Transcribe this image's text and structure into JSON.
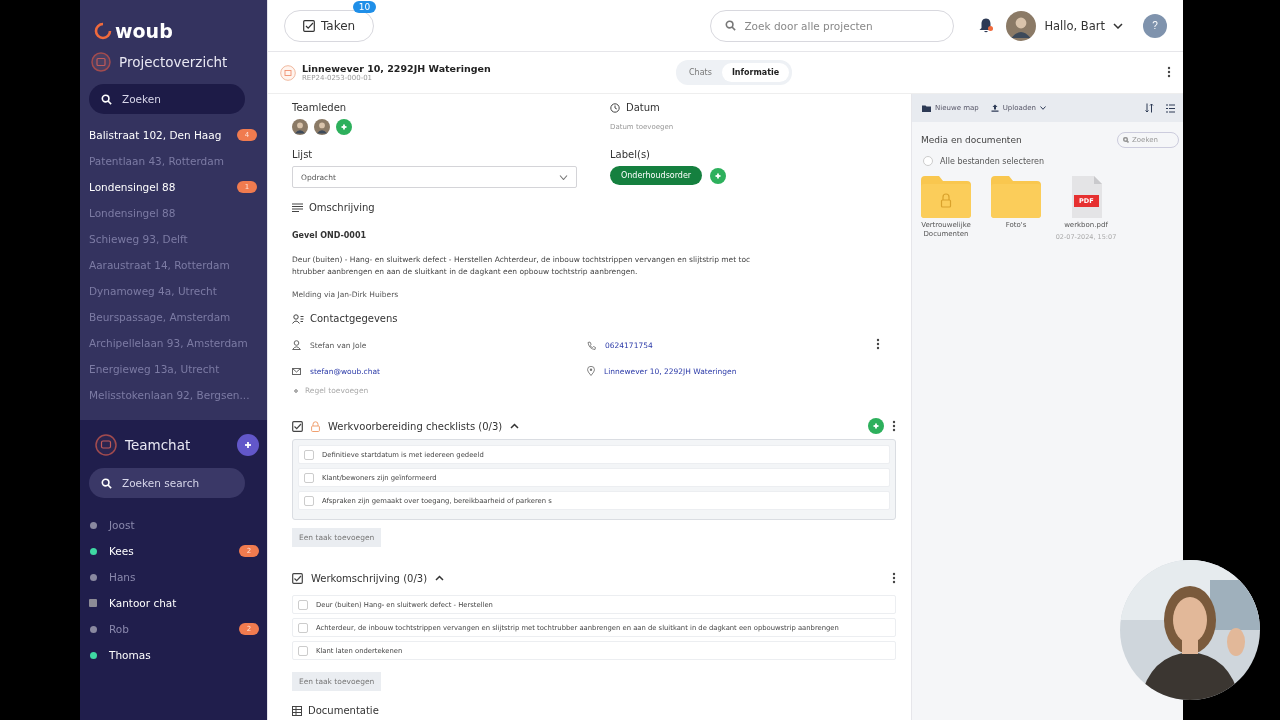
{
  "sidebar": {
    "logo": "woub",
    "projects": {
      "title": "Projectoverzicht",
      "search_placeholder": "Zoeken",
      "items": [
        {
          "label": "Balistraat 102, Den Haag",
          "unread": true,
          "badge": "4"
        },
        {
          "label": "Patentlaan 43, Rotterdam",
          "unread": false
        },
        {
          "label": "Londensingel 88",
          "unread": true,
          "badge": "1"
        },
        {
          "label": "Londensingel 88",
          "unread": false
        },
        {
          "label": "Schieweg 93, Delft",
          "unread": false
        },
        {
          "label": "Aaraustraat 14, Rotterdam",
          "unread": false
        },
        {
          "label": "Dynamoweg 4a, Utrecht",
          "unread": false
        },
        {
          "label": "Beurspassage, Amsterdam",
          "unread": false
        },
        {
          "label": "Archipellelaan 93, Amsterdam",
          "unread": false
        },
        {
          "label": "Energieweg 13a, Utrecht",
          "unread": false
        },
        {
          "label": "Melisstokenlaan 92, Bergsen...",
          "unread": false
        }
      ]
    },
    "teamchat": {
      "title": "Teamchat",
      "search_placeholder": "Zoeken search",
      "contacts": [
        {
          "name": "Joost",
          "kind": "person",
          "online": false
        },
        {
          "name": "Kees",
          "kind": "person",
          "online": true,
          "badge": "2"
        },
        {
          "name": "Hans",
          "kind": "person",
          "online": false
        },
        {
          "name": "Kantoor chat",
          "kind": "group",
          "online": true
        },
        {
          "name": "Rob",
          "kind": "person",
          "online": false,
          "badge": "2"
        },
        {
          "name": "Thomas",
          "kind": "person",
          "online": true
        }
      ]
    }
  },
  "topbar": {
    "tasks_label": "Taken",
    "tasks_badge": "10",
    "search_placeholder": "Zoek door alle projecten",
    "notification": true,
    "greeting": "Hallo, Bart",
    "help": "?"
  },
  "project": {
    "title": "Linnewever 10, 2292JH Wateringen",
    "code": "REP24-0253-000-01",
    "tabs": [
      {
        "label": "Chats",
        "selected": false
      },
      {
        "label": "Informatie",
        "selected": true
      }
    ]
  },
  "details": {
    "team_label": "Teamleden",
    "date_label": "Datum",
    "date_placeholder": "Datum toevoegen",
    "list_label": "Lijst",
    "list_value": "Opdracht",
    "labels_title": "Label(s)",
    "labels": [
      "Onderhoudsorder"
    ],
    "description_heading": "Omschrijving",
    "description_title": "Gevel OND-0001",
    "description_lines": [
      "Deur (buiten) - Hang- en sluitwerk defect - Herstellen Achterdeur, de inbouw tochtstrippen vervangen en slijtstrip met toc",
      "htrubber aanbrengen en aan de sluitkant in de dagkant een opbouw tochtstrip aanbrengen."
    ],
    "reported_by": "Melding via Jan-Dirk Huibers",
    "contact_heading": "Contactgegevens",
    "contact_name": "Stefan van Jole",
    "contact_phone": "0624171754",
    "contact_email": "stefan@woub.chat",
    "contact_address": "Linnewever 10, 2292JH Wateringen",
    "add_row": "Regel toevoegen"
  },
  "checklists": [
    {
      "title": "Werkvoorbereiding checklists (0/3)",
      "locked": true,
      "expanded": true,
      "items": [
        {
          "text": "Definitieve startdatum is met iedereen gedeeld",
          "checked": false
        },
        {
          "text": "Klant/bewoners zijn geïnformeerd",
          "checked": false
        },
        {
          "text": "Afspraken zijn gemaakt over toegang, bereikbaarheid of parkeren s",
          "checked": false
        }
      ],
      "add_task": "Een taak toevoegen"
    },
    {
      "title": "Werkomschrijving (0/3)",
      "locked": false,
      "expanded": true,
      "items": [
        {
          "text": "Deur (buiten) Hang- en sluitwerk defect - Herstellen",
          "checked": false
        },
        {
          "text": "Achterdeur, de inbouw tochtstrippen vervangen en slijtstrip met tochtrubber aanbrengen en aan de sluitkant in de dagkant een opbouwstrip aanbrengen",
          "checked": false
        },
        {
          "text": "Klant laten ondertekenen",
          "checked": false
        }
      ],
      "add_task": "Een taak toevoegen"
    }
  ],
  "documentation_heading": "Documentatie",
  "media": {
    "new_folder": "Nieuwe map",
    "upload": "Uploaden",
    "title": "Media en documenten",
    "search_placeholder": "Zoeken",
    "select_all": "Alle bestanden selecteren",
    "select_all_checked": false,
    "files": [
      {
        "kind": "folder",
        "name": "Vertrouwelijke Documenten",
        "locked": true
      },
      {
        "kind": "folder",
        "name": "Foto's",
        "locked": false
      },
      {
        "kind": "pdf",
        "name": "werkbon.pdf",
        "date": "02-07-2024, 15:07",
        "badge": "PDF"
      }
    ]
  }
}
